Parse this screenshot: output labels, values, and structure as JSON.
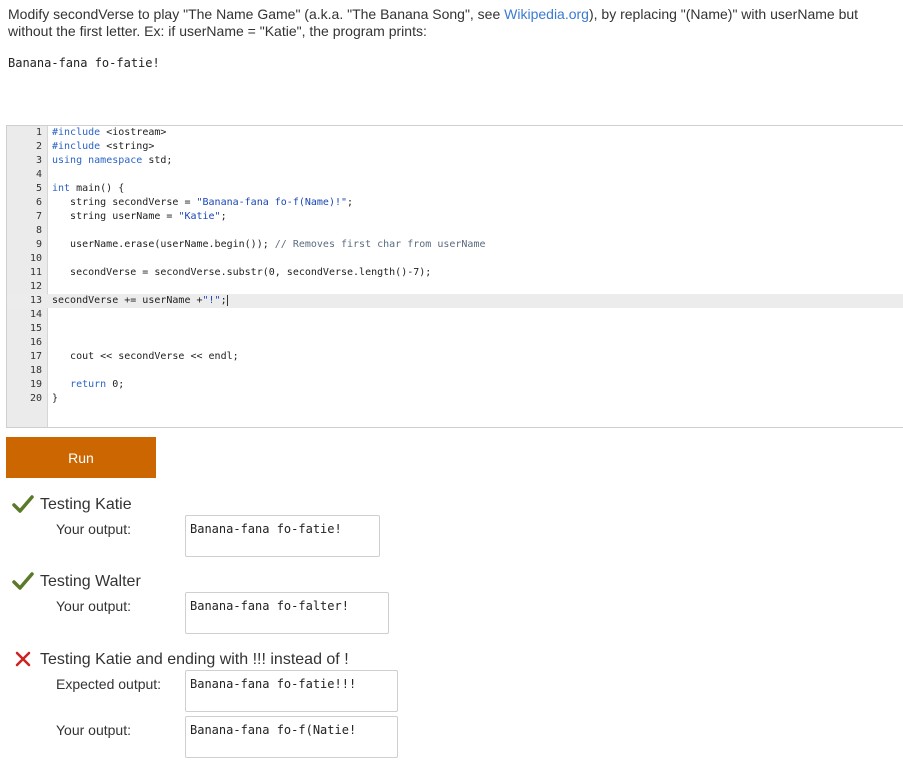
{
  "prompt": {
    "part1": "Modify ",
    "part2": "secondVerse",
    "part3": " to play \"The Name Game\" (a.k.a. \"The Banana Song\", see ",
    "link": "Wikipedia.org",
    "part4": "), by replacing \"(Name)\" with ",
    "part5": "userName",
    "part6": " but without the first letter. Ex: if ",
    "part7": "userName",
    "part8": " = \"Katie\", the program prints:"
  },
  "example_output": "Banana-fana fo-fatie!",
  "editor": {
    "lines": [
      {
        "n": "1",
        "code": "#include <iostream>"
      },
      {
        "n": "2",
        "code": "#include <string>"
      },
      {
        "n": "3",
        "code": "using namespace std;"
      },
      {
        "n": "4",
        "code": ""
      },
      {
        "n": "5",
        "code": "int main() {"
      },
      {
        "n": "6",
        "code": "   string secondVerse = \"Banana-fana fo-f(Name)!\";"
      },
      {
        "n": "7",
        "code": "   string userName = \"Katie\";"
      },
      {
        "n": "8",
        "code": ""
      },
      {
        "n": "9",
        "code": "   userName.erase(userName.begin()); // Removes first char from userName"
      },
      {
        "n": "10",
        "code": ""
      },
      {
        "n": "11",
        "code": "   secondVerse = secondVerse.substr(0, secondVerse.length()-7);"
      },
      {
        "n": "12",
        "code": ""
      },
      {
        "n": "13",
        "code": "secondVerse += userName +\"!\";"
      },
      {
        "n": "14",
        "code": ""
      },
      {
        "n": "15",
        "code": ""
      },
      {
        "n": "16",
        "code": ""
      },
      {
        "n": "17",
        "code": "   cout << secondVerse << endl;"
      },
      {
        "n": "18",
        "code": ""
      },
      {
        "n": "19",
        "code": "   return 0;"
      },
      {
        "n": "20",
        "code": "}"
      }
    ]
  },
  "run_label": "Run",
  "tests": [
    {
      "status": "pass",
      "title": "Testing Katie",
      "your_output_label": "Your output:",
      "your_output": "Banana-fana fo-fatie!"
    },
    {
      "status": "pass",
      "title": "Testing Walter",
      "your_output_label": "Your output:",
      "your_output": "Banana-fana fo-falter!"
    },
    {
      "status": "fail",
      "title": "Testing Katie and ending with !!! instead of !",
      "expected_label": "Expected output:",
      "expected_output": "Banana-fana fo-fatie!!!",
      "your_output_label": "Your output:",
      "your_output": "Banana-fana fo-f(Natie!"
    }
  ],
  "colors": {
    "run_button": "#cc6600",
    "pass_check": "#5a7a2a",
    "fail_x": "#cc2222",
    "link": "#3b7bd0"
  }
}
